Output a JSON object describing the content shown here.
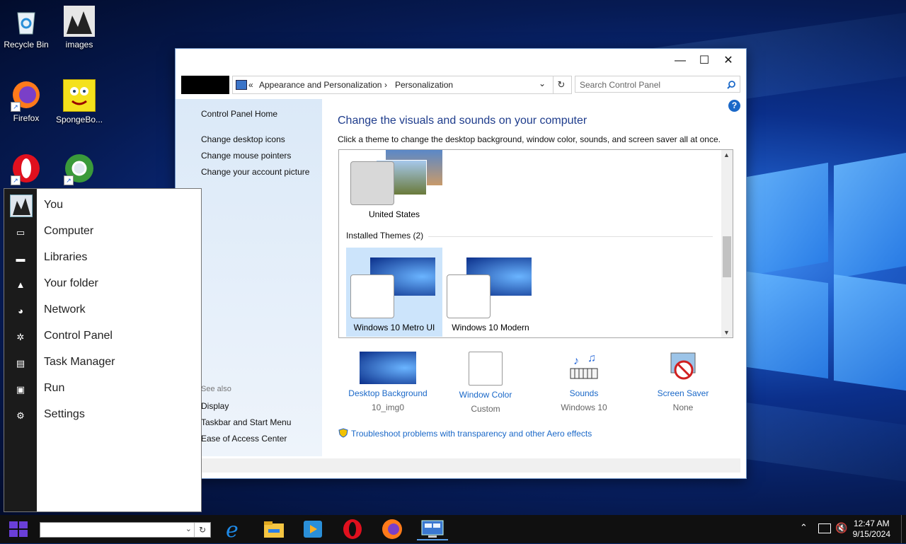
{
  "desktop": {
    "icons": [
      {
        "label": "Recycle Bin",
        "icon": "recycle-bin-icon"
      },
      {
        "label": "images",
        "icon": "image-folder-icon"
      },
      {
        "label": "Firefox",
        "icon": "firefox-icon"
      },
      {
        "label": "SpongeBo...",
        "icon": "spongebob-icon"
      },
      {
        "label": "",
        "icon": "opera-icon"
      },
      {
        "label": "",
        "icon": "chrome-icon"
      }
    ]
  },
  "window": {
    "controls": {
      "minimize": "—",
      "maximize": "☐",
      "close": "✕"
    },
    "address": {
      "prefix": "«",
      "crumb1": "Appearance and Personalization",
      "separator": "›",
      "crumb2": "Personalization",
      "dropdown": "⌄",
      "refresh": "↻"
    },
    "search_placeholder": "Search Control Panel",
    "help": "?",
    "sidebar": {
      "home": "Control Panel Home",
      "links": [
        "Change desktop icons",
        "Change mouse pointers",
        "Change your account picture"
      ],
      "see_also_title": "See also",
      "see_also": [
        "Display",
        "Taskbar and Start Menu",
        "Ease of Access Center"
      ]
    },
    "title": "Change the visuals and sounds on your computer",
    "subtitle": "Click a theme to change the desktop background, window color, sounds, and screen saver all at once.",
    "themes": {
      "my_theme": "United States",
      "installed_header": "Installed Themes (2)",
      "installed": [
        "Windows 10 Metro UI",
        "Windows 10 Modern"
      ],
      "selected_index": 0
    },
    "bottom": [
      {
        "label": "Desktop Background",
        "value": "10_img0"
      },
      {
        "label": "Window Color",
        "value": "Custom"
      },
      {
        "label": "Sounds",
        "value": "Windows 10"
      },
      {
        "label": "Screen Saver",
        "value": "None"
      }
    ],
    "troubleshoot": "Troubleshoot problems with transparency and other Aero effects"
  },
  "start_menu": {
    "items": [
      {
        "label": "You",
        "icon": "user-avatar-icon"
      },
      {
        "label": "Computer",
        "icon": "monitor-icon"
      },
      {
        "label": "Libraries",
        "icon": "folder-icon"
      },
      {
        "label": "Your folder",
        "icon": "user-folder-icon"
      },
      {
        "label": "Network",
        "icon": "network-icon"
      },
      {
        "label": "Control Panel",
        "icon": "control-panel-icon"
      },
      {
        "label": "Task Manager",
        "icon": "task-manager-icon"
      },
      {
        "label": "Run",
        "icon": "run-icon"
      },
      {
        "label": "Settings",
        "icon": "gear-icon"
      }
    ]
  },
  "taskbar": {
    "search_value": "",
    "apps": [
      "internet-explorer-icon",
      "file-explorer-icon",
      "media-player-icon",
      "opera-icon",
      "firefox-icon",
      "control-panel-icon"
    ],
    "time": "12:47 AM",
    "date": "9/15/2024"
  },
  "colors": {
    "accent": "#1a68c8",
    "title": "#1e3c8c",
    "taskbar": "#101010",
    "selection": "#cce4fb"
  }
}
